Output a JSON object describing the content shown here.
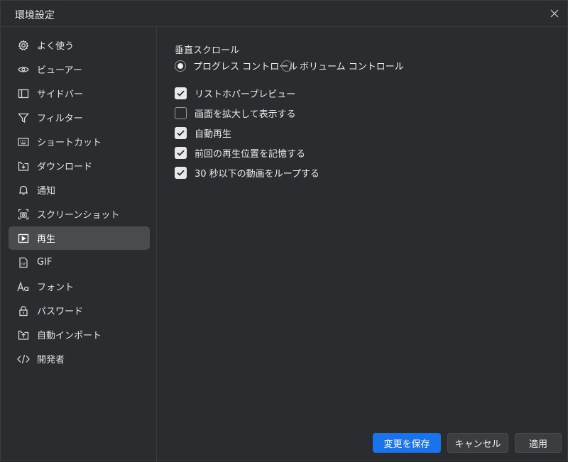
{
  "window": {
    "title": "環境設定"
  },
  "sidebar": {
    "items": [
      {
        "label": "よく使う",
        "icon": "gear-icon"
      },
      {
        "label": "ビューアー",
        "icon": "eye-icon"
      },
      {
        "label": "サイドバー",
        "icon": "sidebar-icon"
      },
      {
        "label": "フィルター",
        "icon": "filter-icon"
      },
      {
        "label": "ショートカット",
        "icon": "keyboard-icon"
      },
      {
        "label": "ダウンロード",
        "icon": "download-icon"
      },
      {
        "label": "通知",
        "icon": "bell-icon"
      },
      {
        "label": "スクリーンショット",
        "icon": "screenshot-icon"
      },
      {
        "label": "再生",
        "icon": "play-icon",
        "selected": true
      },
      {
        "label": "GIF",
        "icon": "gif-file-icon"
      },
      {
        "label": "フォント",
        "icon": "font-icon"
      },
      {
        "label": "パスワード",
        "icon": "lock-icon"
      },
      {
        "label": "自動インポート",
        "icon": "import-icon"
      },
      {
        "label": "開発者",
        "icon": "code-icon"
      }
    ]
  },
  "main": {
    "section_title": "垂直スクロール",
    "scroll_options": [
      {
        "label": "プログレス コントロール",
        "selected": true
      },
      {
        "label": "ボリューム コントロール",
        "selected": false
      }
    ],
    "checkboxes": [
      {
        "label": "リストホバープレビュー",
        "checked": true
      },
      {
        "label": "画面を拡大して表示する",
        "checked": false
      },
      {
        "label": "自動再生",
        "checked": true
      },
      {
        "label": "前回の再生位置を記憶する",
        "checked": true
      },
      {
        "label": "30 秒以下の動画をループする",
        "checked": true
      }
    ]
  },
  "footer": {
    "save_label": "変更を保存",
    "cancel_label": "キャンセル",
    "apply_label": "適用"
  },
  "colors": {
    "background": "#2b2c2f",
    "selected_item": "#4a4b4f",
    "accent": "#1a73e8"
  }
}
